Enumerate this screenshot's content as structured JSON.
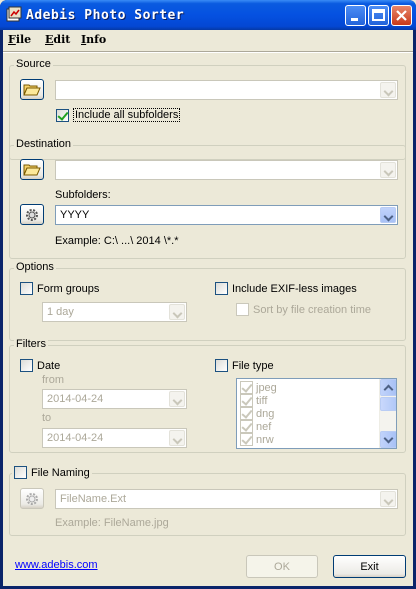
{
  "window": {
    "title": "Adebis Photo Sorter"
  },
  "menu": {
    "file": "File",
    "edit": "Edit",
    "info": "Info"
  },
  "source": {
    "group_label": "Source",
    "path_value": "",
    "include_subfolders_label": "Include all subfolders",
    "include_subfolders_checked": true
  },
  "destination": {
    "group_label": "Destination",
    "path_value": "",
    "subfolders_label": "Subfolders:",
    "subfolders_value": "YYYY",
    "example_text": "Example: C:\\ ...\\ 2014 \\*.*"
  },
  "options": {
    "group_label": "Options",
    "form_groups_label": "Form groups",
    "form_groups_value": "1 day",
    "include_exifless_label": "Include EXIF-less images",
    "sort_by_creation_label": "Sort by file creation time"
  },
  "filters": {
    "group_label": "Filters",
    "date_label": "Date",
    "from_label": "from",
    "from_value": "2014-04-24",
    "to_label": "to",
    "to_value": "2014-04-24",
    "file_type_label": "File type",
    "file_types": [
      "jpeg",
      "tiff",
      "dng",
      "nef",
      "nrw"
    ]
  },
  "file_naming": {
    "group_label": "File Naming",
    "pattern_value": "FileName.Ext",
    "example_text": "Example: FileName.jpg"
  },
  "footer": {
    "link_text": "www.adebis.com",
    "ok_label": "OK",
    "exit_label": "Exit"
  }
}
